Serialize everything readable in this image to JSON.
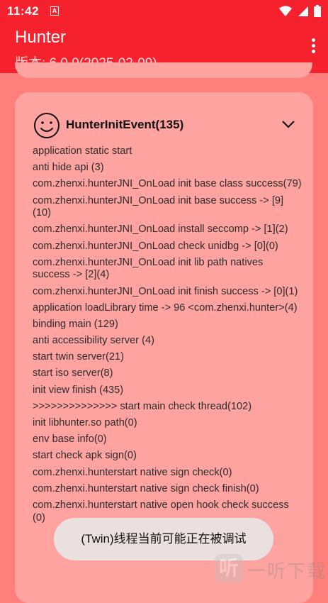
{
  "status_bar": {
    "time": "11:42",
    "notification_icon": "A"
  },
  "app_bar": {
    "title": "Hunter",
    "subtitle": "版本: 6.0.9(2025-02-09)"
  },
  "card": {
    "title": "HunterInitEvent(135)",
    "logs": [
      "application static start",
      "anti hide api (3)",
      "com.zhenxi.hunterJNI_OnLoad init base class success(79)",
      "com.zhenxi.hunterJNI_OnLoad init base success -> [9](10)",
      "com.zhenxi.hunterJNI_OnLoad install seccomp -> [1](2)",
      "com.zhenxi.hunterJNI_OnLoad check unidbg -> [0](0)",
      "com.zhenxi.hunterJNI_OnLoad init lib path natives success -> [2](4)",
      "com.zhenxi.hunterJNI_OnLoad init finish success   -> [0](1)",
      "application loadLibrary time -> 96 <com.zhenxi.hunter>(4)",
      "binding main (129)",
      "anti accessibility server (4)",
      "start twin server(21)",
      "start iso server(8)",
      "init view finish (435)",
      ">>>>>>>>>>>>>> start main check thread(102)",
      "init libhunter.so path(0)",
      "env base info(0)",
      "start check apk sign(0)",
      "com.zhenxi.hunterstart native sign check(0)",
      "com.zhenxi.hunterstart native sign check finish(0)",
      "com.zhenxi.hunterstart native open hook check success (0)"
    ]
  },
  "toast": {
    "message": "(Twin)线程当前可能正在被调试"
  },
  "watermark": {
    "logo": "听",
    "text": "一听下载"
  }
}
